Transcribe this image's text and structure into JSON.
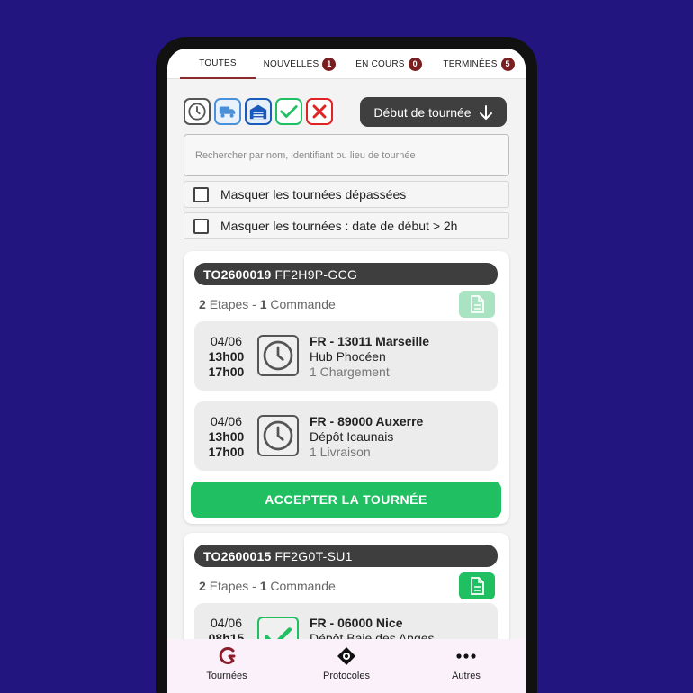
{
  "colors": {
    "background": "#22157f",
    "badge": "#7a1f1f",
    "accent_green": "#1fbf62",
    "header_dark": "#3e3e3e"
  },
  "tabs": [
    {
      "label": "TOUTES",
      "badge": null,
      "active": true
    },
    {
      "label": "NOUVELLES",
      "badge": "1",
      "active": false
    },
    {
      "label": "EN COURS",
      "badge": "0",
      "active": false
    },
    {
      "label": "TERMINÉES",
      "badge": "5",
      "active": false
    }
  ],
  "filters": [
    {
      "icon": "clock-icon",
      "state": "pending"
    },
    {
      "icon": "truck-icon",
      "state": "in-transit"
    },
    {
      "icon": "warehouse-icon",
      "state": "depot"
    },
    {
      "icon": "check-icon",
      "state": "done"
    },
    {
      "icon": "cross-icon",
      "state": "cancelled"
    }
  ],
  "sort": {
    "label": "Début de tournée",
    "icon": "arrow-down-icon"
  },
  "search": {
    "placeholder": "Rechercher par nom, identifiant ou lieu de tournée",
    "value": ""
  },
  "options": [
    {
      "label": "Masquer les tournées dépassées",
      "checked": false
    },
    {
      "label": "Masquer les tournées : date de début > 2h",
      "checked": false
    }
  ],
  "tours": [
    {
      "code": "TO2600019",
      "ref": "FF2H9P-GCG",
      "steps_count": "2",
      "steps_label": "Etapes -",
      "orders_count": "1",
      "orders_label": "Commande",
      "doc_status": "faded",
      "stops": [
        {
          "date": "04/06",
          "start": "13h00",
          "end": "17h00",
          "status_icon": "clock-icon",
          "city": "FR - 13011 Marseille",
          "place": "Hub Phocéen",
          "action": "1 Chargement"
        },
        {
          "date": "04/06",
          "start": "13h00",
          "end": "17h00",
          "status_icon": "clock-icon",
          "city": "FR - 89000 Auxerre",
          "place": "Dépôt Icaunais",
          "action": "1 Livraison"
        }
      ],
      "accept_label": "ACCEPTER LA TOURNÉE"
    },
    {
      "code": "TO2600015",
      "ref": "FF2G0T-SU1",
      "steps_count": "2",
      "steps_label": "Etapes -",
      "orders_count": "1",
      "orders_label": "Commande",
      "doc_status": "active",
      "stops": [
        {
          "date": "04/06",
          "start": "08h15",
          "status_icon": "check-icon",
          "city": "FR - 06000 Nice",
          "place": "Dépôt Baie des Anges"
        }
      ]
    }
  ],
  "nav": [
    {
      "label": "Tournées",
      "icon": "brand-g-icon"
    },
    {
      "label": "Protocoles",
      "icon": "protocol-diamond-icon"
    },
    {
      "label": "Autres",
      "icon": "more-dots-icon"
    }
  ]
}
